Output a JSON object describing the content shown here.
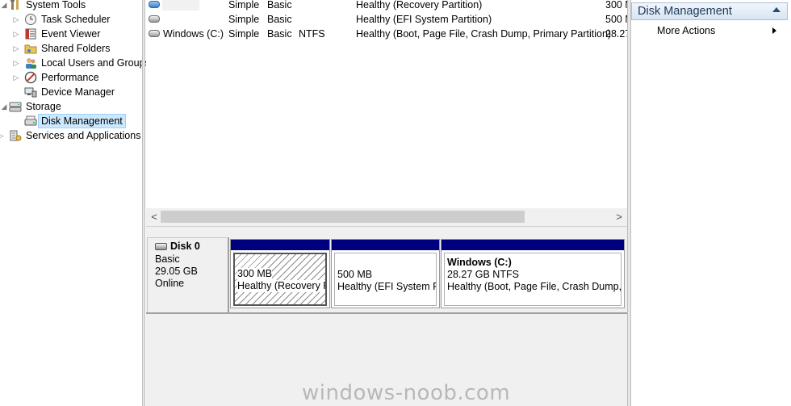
{
  "tree": {
    "items": [
      {
        "label": "System Tools",
        "icon": "tools-icon",
        "indent": 0,
        "expanded": true
      },
      {
        "label": "Task Scheduler",
        "icon": "clock-icon",
        "indent": 1,
        "expanded": false
      },
      {
        "label": "Event Viewer",
        "icon": "event-viewer-icon",
        "indent": 1,
        "expanded": false
      },
      {
        "label": "Shared Folders",
        "icon": "shared-folder-icon",
        "indent": 1,
        "expanded": false
      },
      {
        "label": "Local Users and Groups",
        "icon": "users-icon",
        "indent": 1,
        "expanded": false
      },
      {
        "label": "Performance",
        "icon": "performance-icon",
        "indent": 1,
        "expanded": false
      },
      {
        "label": "Device Manager",
        "icon": "device-manager-icon",
        "indent": 1
      },
      {
        "label": "Storage",
        "icon": "storage-icon",
        "indent": 0,
        "expanded": true
      },
      {
        "label": "Disk Management",
        "icon": "disk-management-icon",
        "indent": 1,
        "selected": true
      },
      {
        "label": "Services and Applications",
        "icon": "services-icon",
        "indent": 0,
        "expanded": false
      }
    ]
  },
  "volumes": {
    "rows": [
      {
        "volume": "",
        "layout": "Simple",
        "type": "Basic",
        "fs": "",
        "status": "Healthy (Recovery Partition)",
        "capacity": "300 M",
        "icon": "blue"
      },
      {
        "volume": "",
        "layout": "Simple",
        "type": "Basic",
        "fs": "",
        "status": "Healthy (EFI System Partition)",
        "capacity": "500 M",
        "icon": "gray"
      },
      {
        "volume": "Windows (C:)",
        "layout": "Simple",
        "type": "Basic",
        "fs": "NTFS",
        "status": "Healthy (Boot, Page File, Crash Dump, Primary Partition)",
        "capacity": "28.27",
        "icon": "gray"
      }
    ]
  },
  "disk": {
    "name": "Disk 0",
    "type": "Basic",
    "size": "29.05 GB",
    "state": "Online",
    "partitions": [
      {
        "title": "",
        "size": "300 MB",
        "status": "Healthy (Recovery Pa"
      },
      {
        "title": "",
        "size": "500 MB",
        "status": "Healthy (EFI System Pa"
      },
      {
        "title": "Windows  (C:)",
        "size": "28.27 GB NTFS",
        "status": "Healthy (Boot, Page File, Crash Dump, P"
      }
    ]
  },
  "actions": {
    "header": "Disk Management",
    "more": "More Actions"
  },
  "scroll": {
    "left": "<",
    "right": ">"
  },
  "watermark": "windows-noob.com",
  "colors": {
    "partition_bar": "#00007f",
    "selection": "#cce8ff",
    "actions_header_text": "#1e395b"
  }
}
